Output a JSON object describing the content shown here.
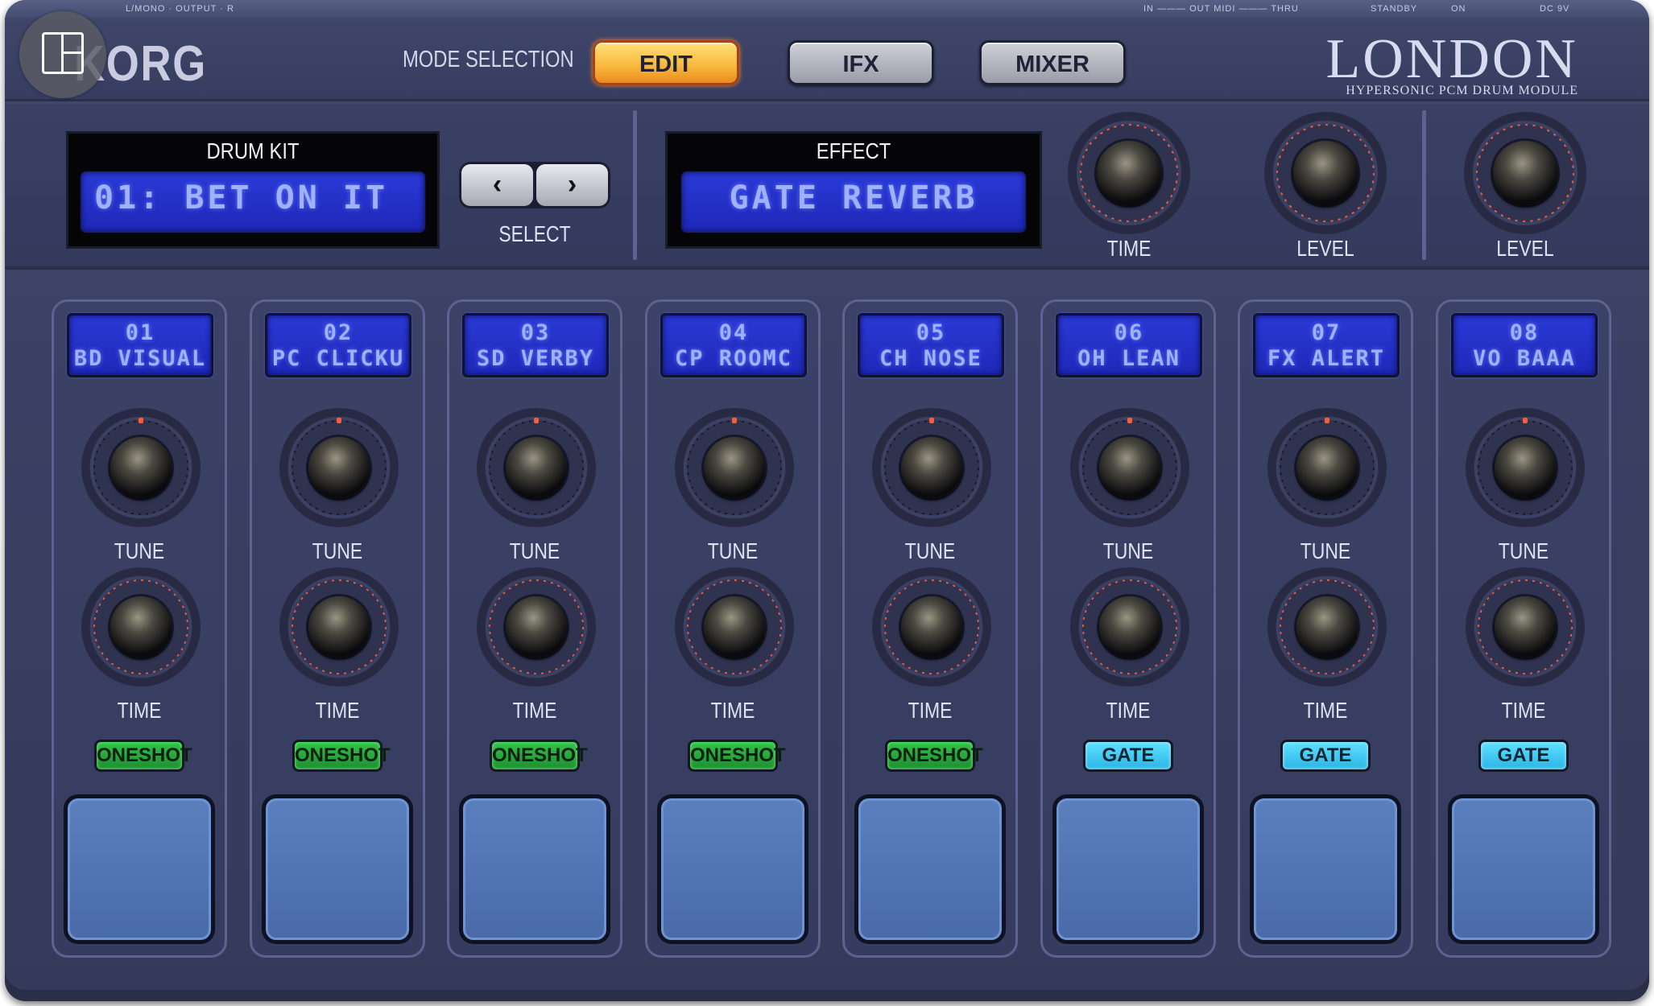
{
  "top_rail": {
    "left": "L/MONO · OUTPUT · R",
    "midi": "IN ——— OUT MIDI ——— THRU",
    "standby": "STANDBY",
    "on": "ON",
    "power": "DC 9V"
  },
  "header": {
    "brand": "KORG",
    "mode_label": "MODE SELECTION",
    "modes": [
      {
        "label": "EDIT",
        "active": true
      },
      {
        "label": "IFX",
        "active": false
      },
      {
        "label": "MIXER",
        "active": false
      }
    ],
    "product_name": "LONDON",
    "product_sub": "HYPERSONIC PCM DRUM MODULE"
  },
  "drum_kit": {
    "title": "DRUM KIT",
    "value": "01: BET ON IT",
    "select_label": "SELECT",
    "prev_icon": "chevron-left-icon",
    "next_icon": "chevron-right-icon"
  },
  "effect": {
    "title": "EFFECT",
    "value": "GATE REVERB",
    "time_label": "TIME",
    "level_label": "LEVEL"
  },
  "master": {
    "level_label": "LEVEL"
  },
  "channels": [
    {
      "num": "01",
      "name": "BD VISUAL",
      "tune_label": "TUNE",
      "time_label": "TIME",
      "mode": "ONESHOT"
    },
    {
      "num": "02",
      "name": "PC CLICKU",
      "tune_label": "TUNE",
      "time_label": "TIME",
      "mode": "ONESHOT"
    },
    {
      "num": "03",
      "name": "SD VERBY",
      "tune_label": "TUNE",
      "time_label": "TIME",
      "mode": "ONESHOT"
    },
    {
      "num": "04",
      "name": "CP ROOMC",
      "tune_label": "TUNE",
      "time_label": "TIME",
      "mode": "ONESHOT"
    },
    {
      "num": "05",
      "name": "CH NOSE",
      "tune_label": "TUNE",
      "time_label": "TIME",
      "mode": "ONESHOT"
    },
    {
      "num": "06",
      "name": "OH LEAN",
      "tune_label": "TUNE",
      "time_label": "TIME",
      "mode": "GATE"
    },
    {
      "num": "07",
      "name": "FX ALERT",
      "tune_label": "TUNE",
      "time_label": "TIME",
      "mode": "GATE"
    },
    {
      "num": "08",
      "name": "VO BAAA",
      "tune_label": "TUNE",
      "time_label": "TIME",
      "mode": "GATE"
    }
  ],
  "colors": {
    "panel": "#3a4064",
    "lcd": "#2434c8",
    "edit_active": "#f7b63a",
    "oneshot": "#2ab545",
    "gate": "#4fd2f7",
    "pad": "#5274b2",
    "knob_ring_red": "#ff5a3a"
  }
}
